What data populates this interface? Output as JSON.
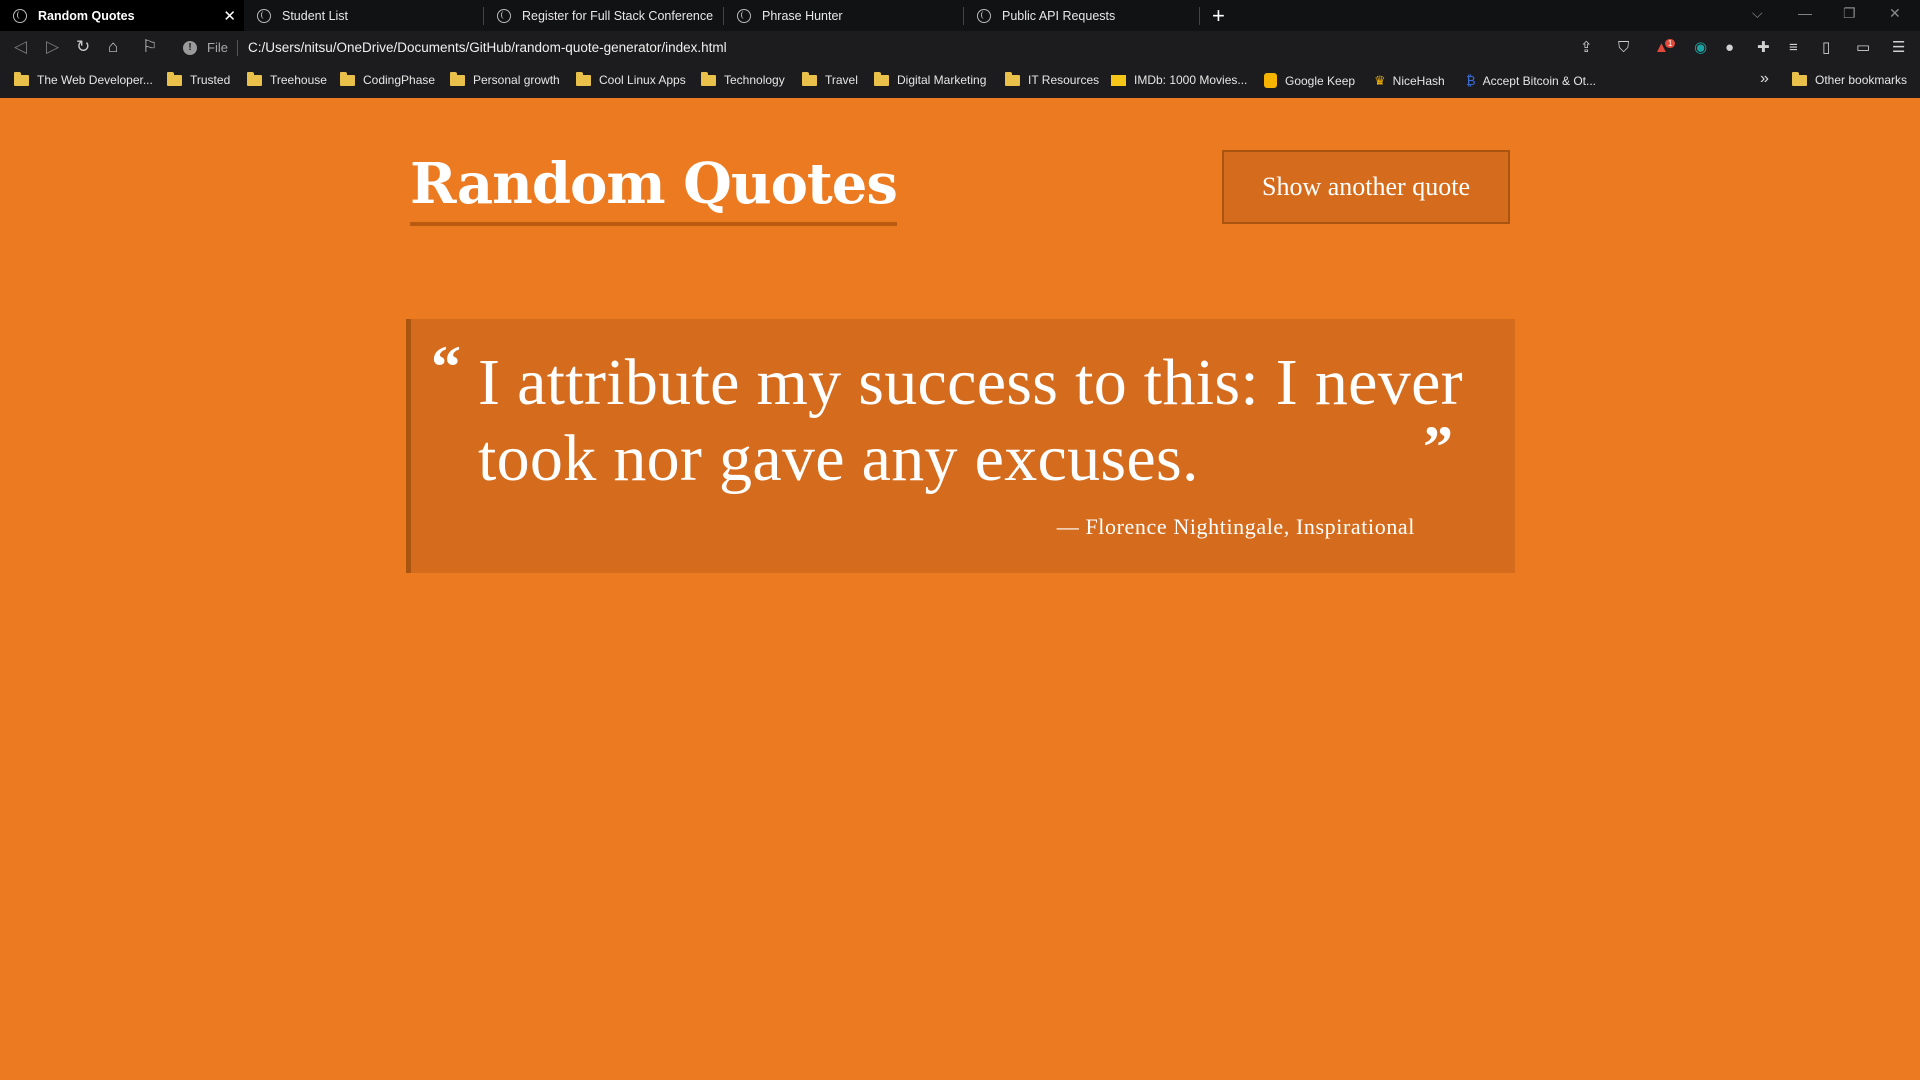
{
  "browser": {
    "tabs": [
      {
        "label": "Random Quotes",
        "active": true
      },
      {
        "label": "Student List"
      },
      {
        "label": "Register for Full Stack Conference"
      },
      {
        "label": "Phrase Hunter"
      },
      {
        "label": "Public API Requests"
      }
    ],
    "address": {
      "file_label": "File",
      "url": "C:/Users/nitsu/OneDrive/Documents/GitHub/random-quote-generator/index.html"
    },
    "bookmarks": [
      {
        "label": "The Web Developer...",
        "icon": "folder-icon"
      },
      {
        "label": "Trusted",
        "icon": "folder-icon"
      },
      {
        "label": "Treehouse",
        "icon": "folder-icon"
      },
      {
        "label": "CodingPhase",
        "icon": "folder-icon"
      },
      {
        "label": "Personal growth",
        "icon": "folder-icon"
      },
      {
        "label": "Cool Linux Apps",
        "icon": "folder-icon"
      },
      {
        "label": "Technology",
        "icon": "folder-icon"
      },
      {
        "label": "Travel",
        "icon": "folder-icon"
      },
      {
        "label": "Digital Marketing",
        "icon": "folder-icon"
      },
      {
        "label": "IT Resources",
        "icon": "folder-icon"
      },
      {
        "label": "IMDb: 1000 Movies...",
        "icon": "imdb-icon"
      },
      {
        "label": "Google Keep",
        "icon": "google-keep-icon"
      },
      {
        "label": "NiceHash",
        "icon": "nicehash-icon"
      },
      {
        "label": "Accept Bitcoin & Ot...",
        "icon": "bitcoin-icon"
      }
    ],
    "other_bookmarks": "Other bookmarks",
    "alert_badge": "1"
  },
  "page": {
    "title": "Random Quotes",
    "button_label": "Show another quote",
    "quote": {
      "text": "I attribute my success to this: I never took nor gave any excuses.",
      "open_mark": "“",
      "close_mark": "”",
      "citation": "— Florence Nightingale, Inspirational"
    }
  },
  "colors": {
    "page_background": "#ec7a20",
    "quote_box": "#d56c1d",
    "accent_border": "#a9540f",
    "text": "#ffffff"
  }
}
